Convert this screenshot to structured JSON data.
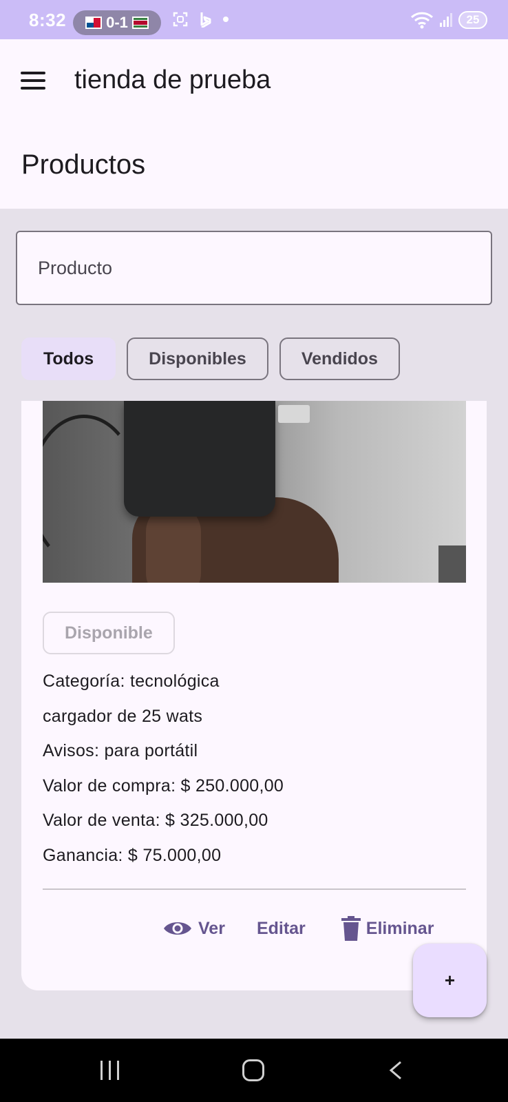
{
  "status_bar": {
    "time": "8:32",
    "score": "0-1",
    "battery": "25"
  },
  "app_bar": {
    "title": "tienda de prueba",
    "page_title": "Productos"
  },
  "search": {
    "placeholder": "Producto"
  },
  "filters": [
    {
      "label": "Todos",
      "selected": true
    },
    {
      "label": "Disponibles",
      "selected": false
    },
    {
      "label": "Vendidos",
      "selected": false
    }
  ],
  "product": {
    "status": "Disponible",
    "details": [
      "Categoría: tecnológica",
      "cargador de 25 wats",
      "Avisos: para portátil",
      "Valor de compra: $ 250.000,00",
      "Valor de venta: $ 325.000,00",
      "Ganancia: $ 75.000,00"
    ],
    "actions": {
      "view": "Ver",
      "edit": "Editar",
      "delete": "Eliminar"
    }
  },
  "fab": {
    "label": "+"
  },
  "colors": {
    "status_bar": "#cbbcf7",
    "surface": "#fdf7ff",
    "background": "#e6e1ea",
    "primary": "#65558f",
    "chip_selected": "#e8def8",
    "fab": "#eaddff"
  },
  "icons": {
    "menu": "menu-icon",
    "view": "eye-icon",
    "delete": "trash-icon"
  }
}
